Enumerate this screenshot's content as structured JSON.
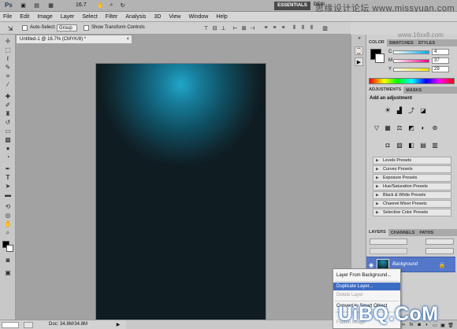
{
  "appbar": {
    "ps_logo": "Ps",
    "zoom": "16.7",
    "essentials": "ESSENTIALS",
    "design": "DESI"
  },
  "menu": [
    "File",
    "Edit",
    "Image",
    "Layer",
    "Select",
    "Filter",
    "Analysis",
    "3D",
    "View",
    "Window",
    "Help"
  ],
  "options": {
    "auto_select_label": "Auto-Select:",
    "auto_select_value": "Group",
    "show_transform_label": "Show Transform Controls"
  },
  "document": {
    "tab_title": "Untitled-1 @ 16.7% (CMYK/8) *"
  },
  "status": {
    "doc": "Doc: 34.8M/34.8M"
  },
  "color_panel": {
    "tabs": [
      "COLOR",
      "SWATCHES",
      "STYLES"
    ],
    "channels": [
      {
        "label": "C",
        "value": "4"
      },
      {
        "label": "M",
        "value": "37"
      },
      {
        "label": "Y",
        "value": "29"
      }
    ]
  },
  "adjustments_panel": {
    "tabs": [
      "ADJUSTMENTS",
      "MASKS"
    ],
    "heading": "Add an adjustment",
    "presets": [
      "Levels Presets",
      "Curves Presets",
      "Exposure Presets",
      "Hue/Saturation Presets",
      "Black & White Presets",
      "Channel Mixer Presets",
      "Selective Color Presets"
    ]
  },
  "layers_panel": {
    "tabs": [
      "LAYERS",
      "CHANNELS",
      "PATHS"
    ],
    "layer_name": "Background"
  },
  "context_menu": {
    "items": [
      {
        "label": "Layer From Background...",
        "state": "normal"
      },
      {
        "label": "Duplicate Layer...",
        "state": "highlighted"
      },
      {
        "label": "Delete Layer",
        "state": "disabled"
      },
      {
        "label": "Convert to Smart Object",
        "state": "normal"
      },
      {
        "label": "Flatten Image",
        "state": "disabled"
      }
    ]
  },
  "watermarks": {
    "top_right": "思缘设计论坛 www.missyuan.com",
    "under_logo": "www.16xx8.com",
    "bottom_right": "UiBQ.CoM"
  },
  "colors": {
    "canvas_glow": "#22a7c9",
    "canvas_dark": "#0f1c21",
    "highlight": "#3d6cc4",
    "layer_selected": "#5577c9",
    "fg_color": "#000000",
    "bg_color": "#ffffff"
  }
}
